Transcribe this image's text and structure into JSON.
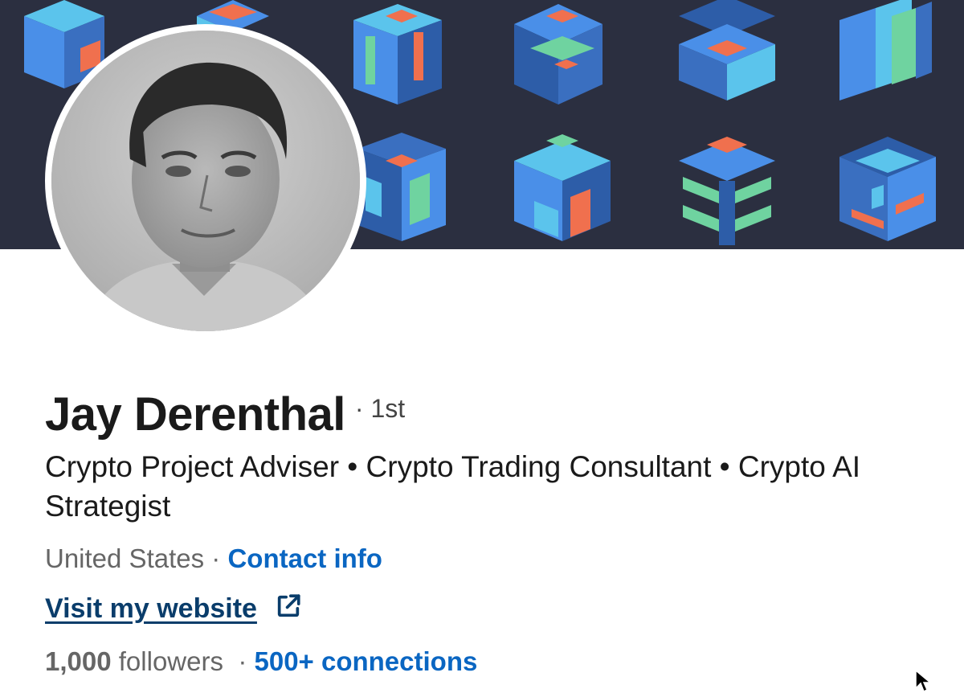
{
  "profile": {
    "name": "Jay Derenthal",
    "degree": "· 1st",
    "headline": "Crypto Project Adviser • Crypto Trading Consultant • Crypto AI Strategist",
    "location": "United States",
    "separator": " · ",
    "contact_info_label": "Contact info",
    "website_label": "Visit my website ",
    "followers_count": "1,000",
    "followers_label": " followers",
    "stats_separator": "  · ",
    "connections_label": "500+ connections"
  },
  "icons": {
    "external_link": "external-link-icon",
    "cursor": "mouse-pointer"
  },
  "colors": {
    "banner_bg": "#2b2f40",
    "link_blue": "#0a66c2",
    "website_blue": "#0a3d6b",
    "muted_text": "#666666",
    "primary_text": "#1a1a1a",
    "shape_blue": "#4a8fe8",
    "shape_light": "#5bc4ec",
    "shape_orange": "#f0704e",
    "shape_green": "#6fd3a0"
  }
}
